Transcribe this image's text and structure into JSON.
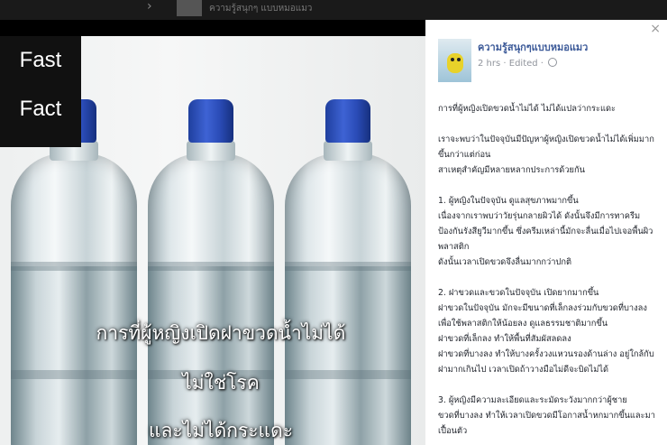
{
  "topbar": {
    "crumb": "ความรู้สนุกๆ แบบหมอแมว"
  },
  "photo": {
    "badge": [
      "Fast",
      "Fact"
    ],
    "caption": [
      "การที่ผู้หญิงเปิดฝาขวดน้ำไม่ได้",
      "ไม่ใช่โรค",
      "และไม่ได้กระแดะ"
    ]
  },
  "post": {
    "page_name": "ความรู้สนุกๆแบบหมอแมว",
    "time": "2 hrs",
    "edited": "Edited",
    "close_label": "×",
    "paragraphs": [
      [
        "การที่ผู้หญิงเปิดขวดน้ำไม่ได้ ไม่ได้แปลว่ากระแดะ"
      ],
      [
        "เราจะพบว่าในปัจจุบันมีปัญหาผู้หญิงเปิดขวดน้ำไม่ได้เพิ่มมาก",
        "ขึ้นกว่าแต่ก่อน",
        "สาเหตุสำคัญมีหลายหลากประการด้วยกัน"
      ],
      [
        "1. ผู้หญิงในปัจจุบัน ดูแลสุขภาพมากขึ้น",
        "เนื่องจากเราพบว่าวัยรุ่นกลายผิวได้ ดังนั้นจึงมีการทาครีม",
        "ป้องกันรังสียูวีมากขึ้น ซึ่งครีมเหล่านี้มักจะลื่นเมื่อไปเจอพื้นผิว",
        "พลาสติก",
        "ดังนั้นเวลาเปิดขวดจึงลื่นมากกว่าปกติ"
      ],
      [
        "2. ฝาขวดและขวดในปัจจุบัน เปิดยากมากขึ้น",
        "ฝาขวดในปัจจุบัน มักจะมีขนาดที่เล็กลงร่วมกับขวดที่บางลง",
        "เพื่อใช้พลาสติกให้น้อยลง ดูแลธรรมชาติมากขึ้น",
        "ฝาขวดที่เล็กลง ทำให้พื้นที่สัมผัสลดลง",
        "ฝาขวดที่บางลง ทำให้บางครั้งวงแหวนรองด้านล่าง อยู่ใกล้กับ",
        "ฝามากเกินไป เวลาเปิดถ้าวางมือไม่ดีจะบิดไม่ได้"
      ],
      [
        "3. ผู้หญิงมีความละเอียดและระมัดระวังมากกว่าผู้ชาย",
        "ขวดที่บางลง ทำให้เวลาเปิดขวดมีโอกาสน้ำหกมากขึ้นและมา",
        "เปื้อนตัว"
      ]
    ]
  }
}
